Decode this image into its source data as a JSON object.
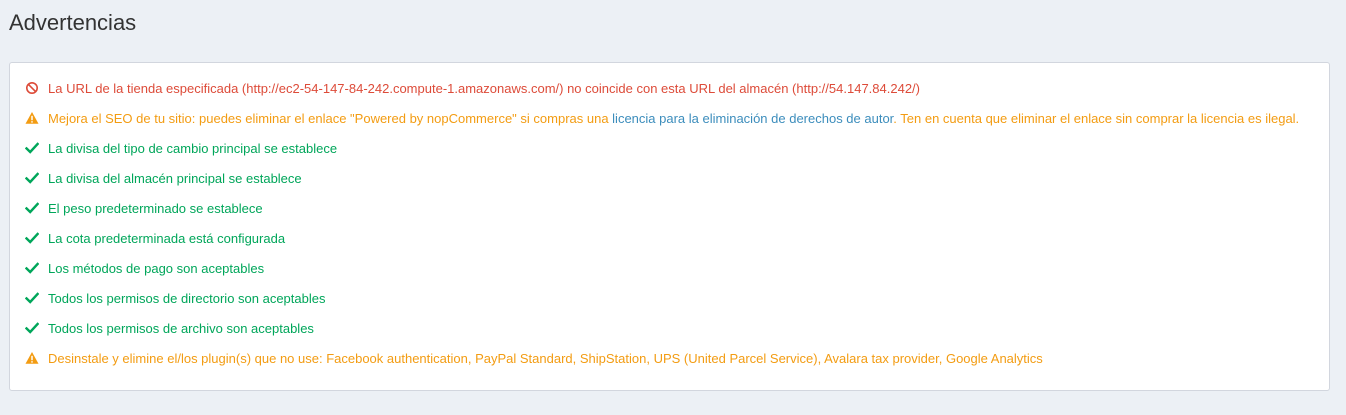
{
  "header": {
    "title": "Advertencias"
  },
  "colors": {
    "fail": "#dd4b39",
    "warning": "#f39c12",
    "pass": "#00a65a",
    "link": "#3c8dbc"
  },
  "warnings": [
    {
      "status": "fail",
      "icon": "ban-icon",
      "text": "La URL de la tienda especificada (http://ec2-54-147-84-242.compute-1.amazonaws.com/) no coincide con esta URL del almacén (http://54.147.84.242/)"
    },
    {
      "status": "warning",
      "icon": "warning-triangle-icon",
      "text_before": "Mejora el SEO de tu sitio: puedes eliminar el enlace \"Powered by nopCommerce\" si compras una ",
      "link_text": "licencia para la eliminación de derechos de autor",
      "text_after": ". Ten en cuenta que eliminar el enlace sin comprar la licencia es ilegal."
    },
    {
      "status": "pass",
      "icon": "checkmark-icon",
      "text": "La divisa del tipo de cambio principal se establece"
    },
    {
      "status": "pass",
      "icon": "checkmark-icon",
      "text": "La divisa del almacén principal se establece"
    },
    {
      "status": "pass",
      "icon": "checkmark-icon",
      "text": "El peso predeterminado se establece"
    },
    {
      "status": "pass",
      "icon": "checkmark-icon",
      "text": "La cota predeterminada está configurada"
    },
    {
      "status": "pass",
      "icon": "checkmark-icon",
      "text": "Los métodos de pago son aceptables"
    },
    {
      "status": "pass",
      "icon": "checkmark-icon",
      "text": "Todos los permisos de directorio son aceptables"
    },
    {
      "status": "pass",
      "icon": "checkmark-icon",
      "text": "Todos los permisos de archivo son aceptables"
    },
    {
      "status": "warning",
      "icon": "warning-triangle-icon",
      "text": "Desinstale y elimine el/los plugin(s) que no use: Facebook authentication, PayPal Standard, ShipStation, UPS (United Parcel Service), Avalara tax provider, Google Analytics"
    }
  ]
}
